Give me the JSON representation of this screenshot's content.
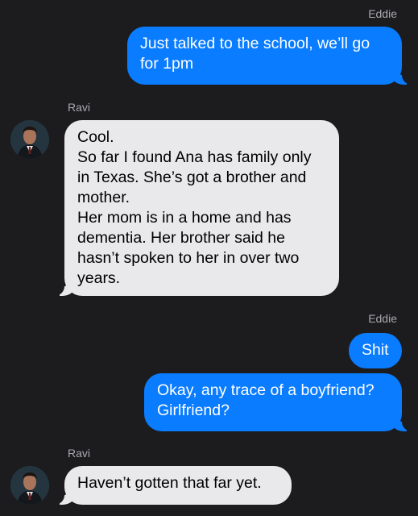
{
  "conversation": {
    "messages": [
      {
        "sender": "Eddie",
        "direction": "outgoing",
        "text": "Just talked to the school, we’ll go\nfor 1pm"
      },
      {
        "sender": "Ravi",
        "direction": "incoming",
        "text": "Cool.\nSo far I found Ana has family only\nin Texas. She’s got a brother and\nmother.\nHer mom is in a home and has\ndementia. Her brother said he\nhasn’t spoken to her in over two\nyears."
      },
      {
        "sender": "Eddie",
        "direction": "outgoing",
        "text": "Shit"
      },
      {
        "sender": "Eddie",
        "direction": "outgoing",
        "text": "Okay, any trace of a boyfriend?\nGirlfriend?"
      },
      {
        "sender": "Ravi",
        "direction": "incoming",
        "text": "Haven’t gotten that far yet."
      }
    ]
  },
  "colors": {
    "background": "#1c1c1e",
    "outgoing_bubble": "#0a7cff",
    "incoming_bubble": "#e9e9eb",
    "sender_label": "#a9a9ae"
  }
}
